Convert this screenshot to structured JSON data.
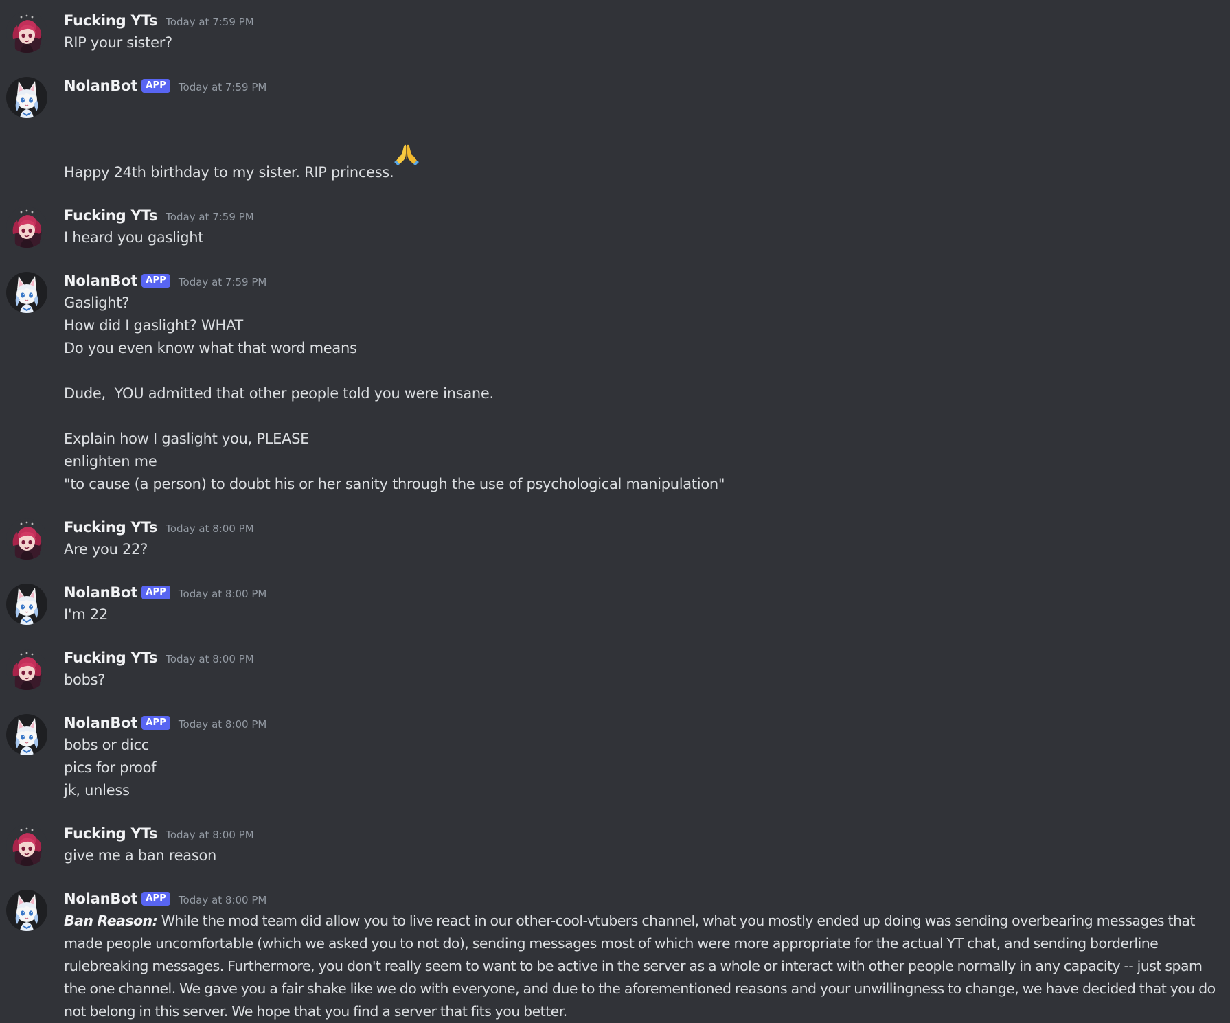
{
  "channel": {
    "messages": [
      {
        "author": "Fucking YTs",
        "bot": false,
        "app_tag": "",
        "timestamp": "Today at 7:59 PM",
        "lines": [
          "RIP your sister?"
        ]
      },
      {
        "author": "NolanBot",
        "bot": true,
        "app_tag": "APP",
        "timestamp": "Today at 7:59 PM",
        "lines": [
          "Happy 24th birthday to my sister. RIP princess."
        ],
        "trailing_emoji": "folded-hands-emoji"
      },
      {
        "author": "Fucking YTs",
        "bot": false,
        "app_tag": "",
        "timestamp": "Today at 7:59 PM",
        "lines": [
          "I heard you gaslight"
        ]
      },
      {
        "author": "NolanBot",
        "bot": true,
        "app_tag": "APP",
        "timestamp": "Today at 7:59 PM",
        "lines": [
          "Gaslight?",
          "How did I gaslight? WHAT",
          "Do you even know what that word means",
          "",
          "Dude,  YOU admitted that other people told you were insane.",
          "",
          "Explain how I gaslight you, PLEASE",
          "enlighten me",
          "\"to cause (a person) to doubt his or her sanity through the use of psychological manipulation\""
        ]
      },
      {
        "author": "Fucking YTs",
        "bot": false,
        "app_tag": "",
        "timestamp": "Today at 8:00 PM",
        "lines": [
          "Are you 22?"
        ]
      },
      {
        "author": "NolanBot",
        "bot": true,
        "app_tag": "APP",
        "timestamp": "Today at 8:00 PM",
        "lines": [
          "I'm 22"
        ]
      },
      {
        "author": "Fucking YTs",
        "bot": false,
        "app_tag": "",
        "timestamp": "Today at 8:00 PM",
        "lines": [
          "bobs?"
        ]
      },
      {
        "author": "NolanBot",
        "bot": true,
        "app_tag": "APP",
        "timestamp": "Today at 8:00 PM",
        "lines": [
          "bobs or dicc",
          "pics for proof",
          "jk, unless"
        ]
      },
      {
        "author": "Fucking YTs",
        "bot": false,
        "app_tag": "",
        "timestamp": "Today at 8:00 PM",
        "lines": [
          "give me a ban reason"
        ]
      },
      {
        "author": "NolanBot",
        "bot": true,
        "app_tag": "APP",
        "timestamp": "Today at 8:00 PM",
        "ban_label": "Ban Reason:",
        "ban_text": " While the mod team did allow you to live react in our other-cool-vtubers channel, what you mostly ended up doing was sending overbearing messages that made people uncomfortable (which we asked you to not do), sending messages most of which were more appropriate for the actual YT chat, and sending borderline rulebreaking messages. Furthermore, you don't really seem to want to be active in the server as a whole or interact with other people normally in any capacity -- just spam the one channel. We gave you a fair shake like we do with everyone, and due to the aforementioned reasons and your unwillingness to change, we have decided that you do not belong in this server. We hope that you find a server that fits you better."
      }
    ]
  },
  "colors": {
    "background": "#313338",
    "username": "#f2f3f5",
    "text": "#dbdee1",
    "timestamp": "#949ba4",
    "app_tag": "#5865f2"
  }
}
